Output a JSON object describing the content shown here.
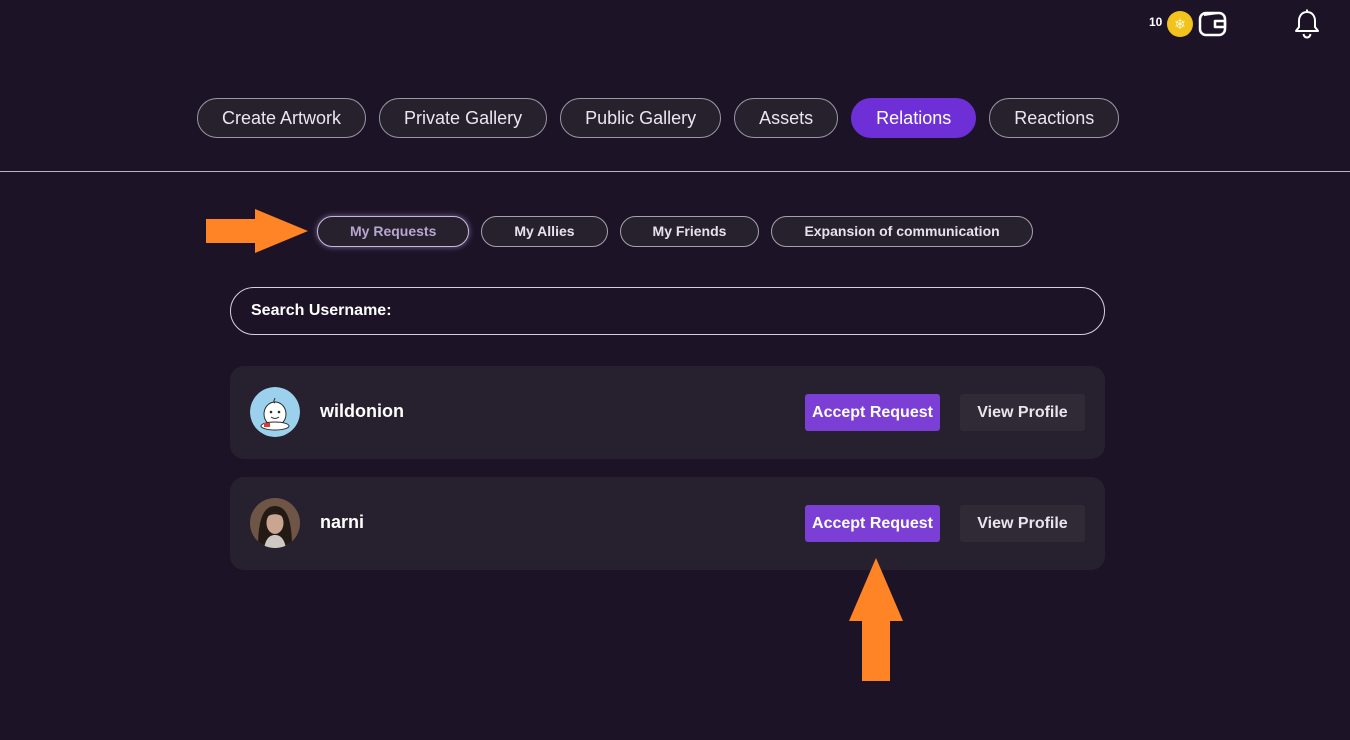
{
  "topbar": {
    "coin_count": "10",
    "coin_icon": "coin-icon",
    "wallet_icon": "wallet-icon",
    "bell_icon": "bell-icon",
    "coin_color": "#f2c21d"
  },
  "main_nav": {
    "items": [
      {
        "label": "Create Artwork"
      },
      {
        "label": "Private Gallery"
      },
      {
        "label": "Public Gallery"
      },
      {
        "label": "Assets"
      },
      {
        "label": "Relations",
        "active": true
      },
      {
        "label": "Reactions"
      }
    ],
    "accent_color": "#6e2fd6"
  },
  "sub_tabs": {
    "items": [
      {
        "label": "My Requests",
        "active": true
      },
      {
        "label": "My Allies"
      },
      {
        "label": "My Friends"
      },
      {
        "label": "Expansion of communication"
      }
    ]
  },
  "search": {
    "label": "Search Username:",
    "value": ""
  },
  "requests": [
    {
      "username": "wildonion",
      "accept_label": "Accept Request",
      "profile_label": "View Profile",
      "avatar": "cartoon-avatar"
    },
    {
      "username": "narni",
      "accept_label": "Accept Request",
      "profile_label": "View Profile",
      "avatar": "photo-avatar"
    }
  ],
  "annotations": {
    "arrow_color": "#ff8426"
  }
}
